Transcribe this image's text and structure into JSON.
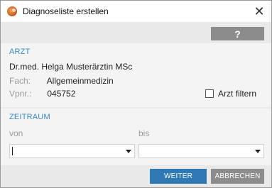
{
  "window": {
    "title": "Diagnoseliste erstellen",
    "close_glyph": "✕",
    "app_icon": "app-logo-icon"
  },
  "toolbar": {
    "help_label": "?"
  },
  "arzt": {
    "section_title": "ARZT",
    "name": "Dr.med. Helga Musterärztin MSc",
    "fach_label": "Fach:",
    "fach_value": "Allgemeinmedizin",
    "vpnr_label": "Vpnr.:",
    "vpnr_value": "045752",
    "filter_label": "Arzt filtern",
    "filter_checked": false
  },
  "zeitraum": {
    "section_title": "ZEITRAUM",
    "von_label": "von",
    "bis_label": "bis",
    "von_value": "",
    "bis_value": ""
  },
  "footer": {
    "weiter_label": "WEITER",
    "abbrechen_label": "ABBRECHEN"
  },
  "colors": {
    "accent": "#2f78b4",
    "section_title": "#3a87c7",
    "secondary_button": "#8c8c8c"
  }
}
